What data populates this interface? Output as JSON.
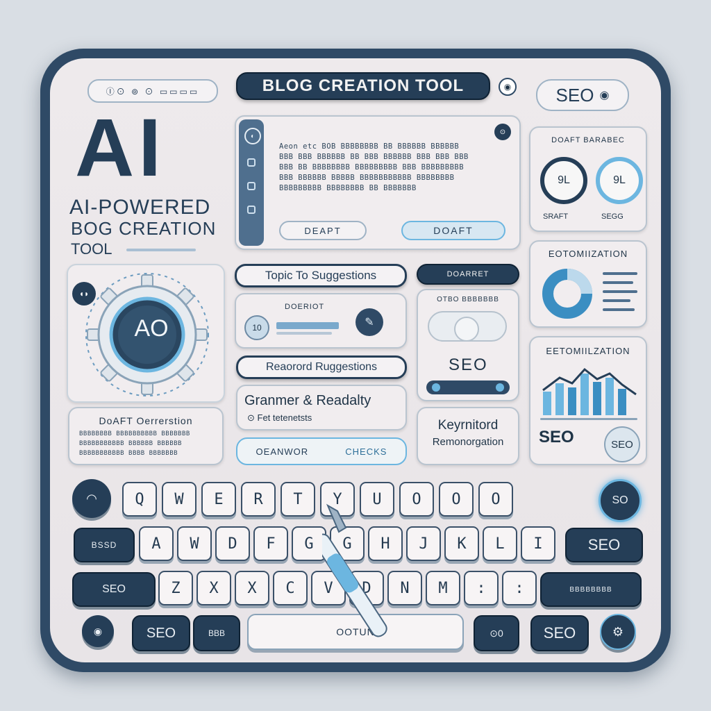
{
  "colors": {
    "accent": "#3b8ec2",
    "navy": "#253e57",
    "panel": "#f1edef",
    "highlight": "#6cb6e0"
  },
  "header": {
    "title": "BLOG CREATION TOOL",
    "left_strip": "Ⓘ⊙ ⊚ ⊙ ▭▭▭▭",
    "seo_button": "SEO"
  },
  "hero": {
    "big": "AI",
    "line1": "AI-POWERED",
    "line2": "BOG CREATION",
    "line3": "TOOL"
  },
  "gear": {
    "label": "AO",
    "side_badge": "◖◗"
  },
  "draft_box": {
    "lines": [
      "Aeon etc BOB BBBBBBBB BB BBBBBB BBBBBB",
      "BBB BBB BBBBBB BB BBB BBBBBB BBB BBB BBB",
      "BBB BB BBBBBBBB BBBBBBBBB BBB BBBBBBBBB",
      "BBB BBBBBB BBBBB BBBBBBBBBBB BBBBBBBB",
      "BBBBBBBBB BBBBBBBB BB BBBBBBB"
    ],
    "button1": "DEAPT",
    "button2": "DOAFT"
  },
  "draft_panel": {
    "title": "DOAFT BARABEC",
    "g1": "9L",
    "g2": "9L",
    "l1": "SRAFT",
    "l2": "SEGG"
  },
  "topic": {
    "title": "Topic To Suggestions",
    "inner_label": "DOERIOT",
    "chip": "10"
  },
  "keyword": {
    "title": "Reaorord Ruggestions"
  },
  "grammar": {
    "line1": "Granmer & Readalty",
    "line2": "⊙ Fet tetenetsts",
    "btn1": "OEANWOR",
    "btn2": "CHECKS"
  },
  "draft_card": {
    "title": "DoAFT Oerrerstion",
    "lines": [
      "BBBBBBBB BBBBBBBBBB BBBBBBB",
      "BBBBBBBBBBB BBBBBB BBBBBB",
      "BBBBBBBBBBB BBBB BBBBBBB"
    ]
  },
  "seo_mid": {
    "tab": "DOARRET",
    "sub": "OTBO BBBBBBB",
    "label": "SEO"
  },
  "keyword_card": {
    "line1": "Keyrnitord",
    "line2": "Remonorgation"
  },
  "opt1": {
    "title": "EOTOMIIZATION"
  },
  "opt2": {
    "title": "EETOMIILZATION",
    "seo1": "SEO",
    "seo2": "SEO"
  },
  "keyboard": {
    "row1": [
      "Q",
      "W",
      "E",
      "R",
      "T",
      "Y",
      "U",
      "O",
      "O",
      "O"
    ],
    "row2": [
      "A",
      "W",
      "D",
      "F",
      "G",
      "G",
      "H",
      "J",
      "K",
      "L",
      "I"
    ],
    "row3": [
      "Z",
      "X",
      "X",
      "C",
      "V",
      "D",
      "N",
      "M",
      ":",
      ":"
    ],
    "left_mid": "BSSD",
    "left_low": "SEO",
    "right_mid": "SEO",
    "right_low": "BBBBBBBB",
    "top_right": "SO",
    "bottom_seo": "SEO",
    "bottom_seo2": "SEO",
    "bottom_key2": "BBB",
    "bottom_key3": "⊙0",
    "space": "OOTUN"
  }
}
